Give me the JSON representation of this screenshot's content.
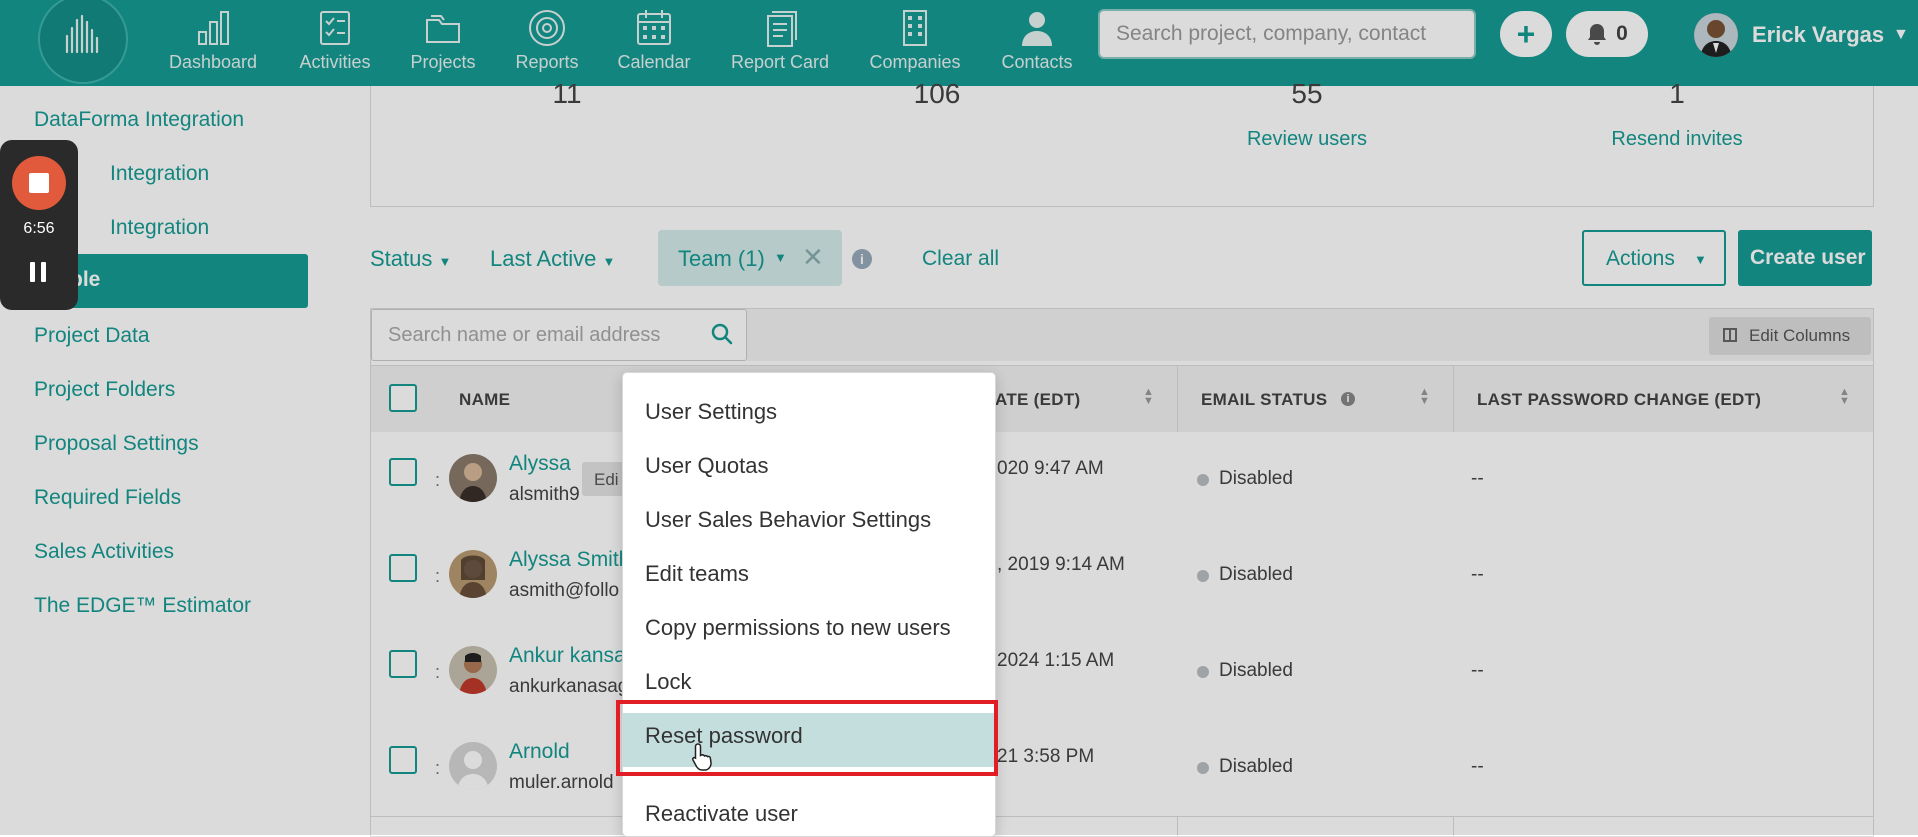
{
  "header": {
    "nav": [
      {
        "label": "Dashboard",
        "icon": "dashboard-icon"
      },
      {
        "label": "Activities",
        "icon": "activities-icon"
      },
      {
        "label": "Projects",
        "icon": "projects-icon"
      },
      {
        "label": "Reports",
        "icon": "reports-icon"
      },
      {
        "label": "Calendar",
        "icon": "calendar-icon"
      },
      {
        "label": "Report Card",
        "icon": "report-card-icon"
      },
      {
        "label": "Companies",
        "icon": "companies-icon"
      },
      {
        "label": "Contacts",
        "icon": "contacts-icon"
      }
    ],
    "search_placeholder": "Search project, company, contact",
    "plus_label": "+",
    "notifications_count": "0",
    "user_name": "Erick Vargas",
    "brand_color": "#169b94"
  },
  "sidebar": {
    "items": [
      {
        "label": "DataForma Integration"
      },
      {
        "label": "Integration"
      },
      {
        "label": "Integration"
      },
      {
        "label": "ple"
      },
      {
        "label": "Project Data"
      },
      {
        "label": "Project Folders"
      },
      {
        "label": "Proposal Settings"
      },
      {
        "label": "Required Fields"
      },
      {
        "label": "Sales Activities"
      },
      {
        "label": "The EDGE™ Estimator"
      }
    ]
  },
  "recorder": {
    "time": "6:56"
  },
  "stats": [
    {
      "value": "11",
      "link": ""
    },
    {
      "value": "106",
      "link": ""
    },
    {
      "value": "55",
      "link": "Review users"
    },
    {
      "value": "1",
      "link": "Resend invites"
    }
  ],
  "filters": {
    "status": "Status",
    "last_active": "Last Active",
    "team": "Team (1)",
    "info": "i",
    "clear_all": "Clear all",
    "actions": "Actions",
    "create_user": "Create user"
  },
  "table": {
    "search_placeholder": "Search name or email address",
    "edit_columns": "Edit Columns",
    "headers": {
      "name": "NAME",
      "date": "ATE (EDT)",
      "email_status": "EMAIL STATUS",
      "last_password": "LAST PASSWORD CHANGE (EDT)"
    },
    "rows": [
      {
        "name": "Alyssa",
        "email": "alsmith9",
        "date": "020 9:47 AM",
        "status": "Disabled",
        "password": "--"
      },
      {
        "name": "Alyssa Smith",
        "email": "asmith@follo",
        "date": ", 2019 9:14 AM",
        "status": "Disabled",
        "password": "--"
      },
      {
        "name": "Ankur kansa",
        "email": "ankurkanasag",
        "date": "2024 1:15 AM",
        "status": "Disabled",
        "password": "--"
      },
      {
        "name": "Arnold",
        "email": "muler.arnold",
        "date": "21 3:58 PM",
        "status": "Disabled",
        "password": "--"
      }
    ],
    "edit_tooltip": "Edi"
  },
  "context_menu": {
    "items": [
      "User Settings",
      "User Quotas",
      "User Sales Behavior Settings",
      "Edit teams",
      "Copy permissions to new users",
      "Lock",
      "Reset password",
      "Reactivate user"
    ],
    "highlighted": "Reset password",
    "highlight_color": "#e11d26"
  }
}
